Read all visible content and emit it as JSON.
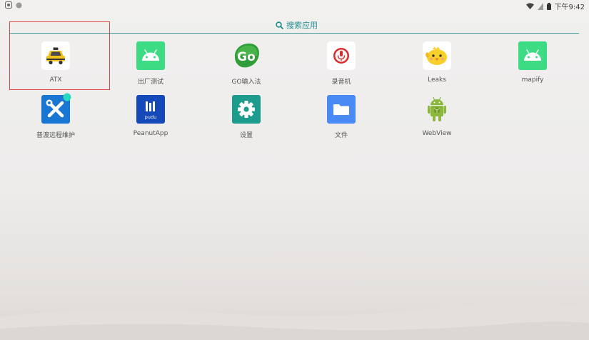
{
  "status_bar": {
    "time": "下午9:42",
    "icons": [
      "sim-icon",
      "dot-icon",
      "wifi-icon",
      "signal-icon",
      "battery-icon"
    ]
  },
  "search": {
    "label": "搜索应用",
    "icon": "search-icon"
  },
  "apps": [
    {
      "label": "ATX",
      "icon": "taxi-icon",
      "selected": true
    },
    {
      "label": "出厂测试",
      "icon": "android-icon"
    },
    {
      "label": "GO输入法",
      "icon": "go-keyboard-icon"
    },
    {
      "label": "录音机",
      "icon": "microphone-icon"
    },
    {
      "label": "Leaks",
      "icon": "bird-icon"
    },
    {
      "label": "mapify",
      "icon": "android-icon"
    },
    {
      "label": "普渡远程维护",
      "icon": "tools-icon"
    },
    {
      "label": "PeanutApp",
      "icon": "pudu-icon",
      "icon_text": "pudu"
    },
    {
      "label": "设置",
      "icon": "gear-icon"
    },
    {
      "label": "文件",
      "icon": "folder-icon"
    },
    {
      "label": "WebView",
      "icon": "android-robot-icon"
    }
  ],
  "colors": {
    "accent": "#1f8a8e",
    "selection": "#e04848",
    "android_green": "#3ddc84",
    "settings_teal": "#1d9b8c",
    "files_blue": "#4a8af4",
    "tools_blue": "#1976d2",
    "pudu_blue": "#1548b8"
  }
}
